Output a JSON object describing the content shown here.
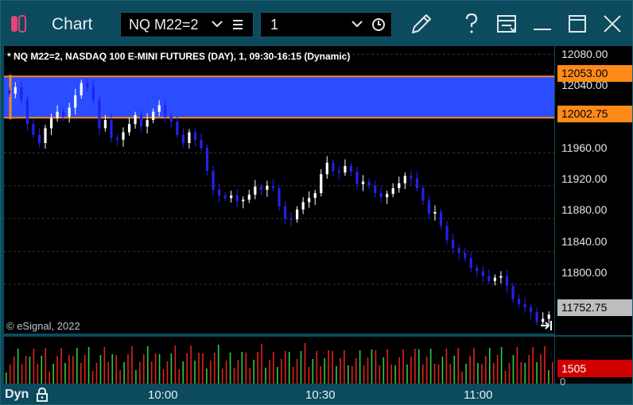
{
  "window": {
    "title": "Chart",
    "symbol": "NQ M22=2",
    "interval": "1"
  },
  "chart": {
    "header": "* NQ M22=2, NASDAQ 100 E-MINI FUTURES (DAY), 1, 09:30-16:15 (Dynamic)",
    "copyright": "© eSignal, 2022",
    "price_labels": [
      "12080.00",
      "12040.00",
      "11960.00",
      "11920.00",
      "11880.00",
      "11840.00",
      "11800.00"
    ],
    "upper_zone_tag": "12053.00",
    "lower_zone_tag": "12002.75",
    "last_price_tag": "11752.75",
    "volume_tag": "1505",
    "volume_zero": "0",
    "time_labels": [
      "10:00",
      "10:30",
      "11:00"
    ],
    "mode_label": "Dyn",
    "colors": {
      "zone_fill": "#2a4dff",
      "zone_border": "#ff8a1a",
      "up_candle": "#ffffff",
      "down_candle": "#2222ee",
      "volume_up": "#2ecc40",
      "volume_down": "#e02020",
      "frame": "#0c4a5e"
    }
  },
  "chart_data": {
    "type": "candlestick",
    "title": "NQ M22=2, NASDAQ 100 E-MINI FUTURES (DAY), 1, 09:30-16:15 (Dynamic)",
    "ylim": [
      11740,
      12090
    ],
    "price_axis_ticks": [
      12080,
      12040,
      11960,
      11920,
      11880,
      11840,
      11800
    ],
    "x_ticks": [
      "10:00",
      "10:30",
      "11:00"
    ],
    "zone": {
      "upper": 12053.0,
      "lower": 12002.75
    },
    "last": 11752.75,
    "last_volume": 1505,
    "closes": [
      12032,
      12040,
      12025,
      11995,
      11982,
      11972,
      11990,
      12002,
      12010,
      12004,
      12015,
      12030,
      12045,
      12040,
      12025,
      11990,
      12000,
      11978,
      11976,
      11985,
      11995,
      12006,
      11992,
      12000,
      12010,
      12018,
      12004,
      11998,
      11982,
      11972,
      11985,
      11976,
      11966,
      11938,
      11915,
      11908,
      11905,
      11908,
      11901,
      11903,
      11909,
      11919,
      11915,
      11920,
      11917,
      11895,
      11880,
      11879,
      11891,
      11900,
      11905,
      11911,
      11934,
      11948,
      11938,
      11936,
      11944,
      11937,
      11922,
      11925,
      11920,
      11911,
      11906,
      11910,
      11917,
      11923,
      11932,
      11929,
      11917,
      11902,
      11886,
      11888,
      11871,
      11854,
      11844,
      11838,
      11832,
      11820,
      11816,
      11810,
      11804,
      11808,
      11810,
      11798,
      11782,
      11776,
      11772,
      11766,
      11754,
      11758,
      11763
    ]
  }
}
